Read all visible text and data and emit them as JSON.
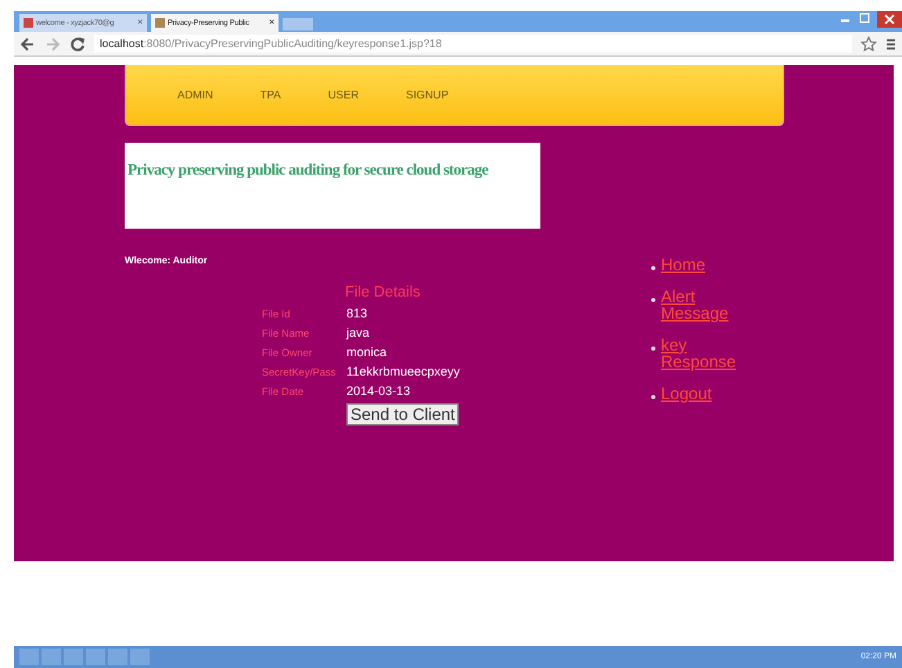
{
  "browser": {
    "tabs": [
      {
        "title": "welcome - xyzjack70@g",
        "selected": false
      },
      {
        "title": "Privacy-Preserving Public",
        "selected": true
      }
    ],
    "tab_close": "×",
    "url_host": "localhost",
    "url_rest": ":8080/PrivacyPreservingPublicAuditing/keyresponse1.jsp?18"
  },
  "nav": {
    "items": [
      "ADMIN",
      "TPA",
      "USER",
      "SIGNUP"
    ]
  },
  "banner": {
    "title": "Privacy preserving public auditing for secure cloud storage"
  },
  "welcome": "Wlecome: Auditor",
  "details": {
    "heading": "File Details",
    "rows": [
      {
        "label": "File Id",
        "value": "813"
      },
      {
        "label": "File Name",
        "value": "java"
      },
      {
        "label": "File Owner",
        "value": "monica"
      },
      {
        "label": "SecretKey/Pass",
        "value": "11ekkrbmueecpxeyy"
      },
      {
        "label": "File Date",
        "value": "2014-03-13"
      }
    ],
    "button": "Send to Client"
  },
  "links": [
    "Home",
    "Alert Message",
    "key Response",
    "Logout"
  ],
  "taskbar": {
    "clock": "02:20 PM"
  }
}
